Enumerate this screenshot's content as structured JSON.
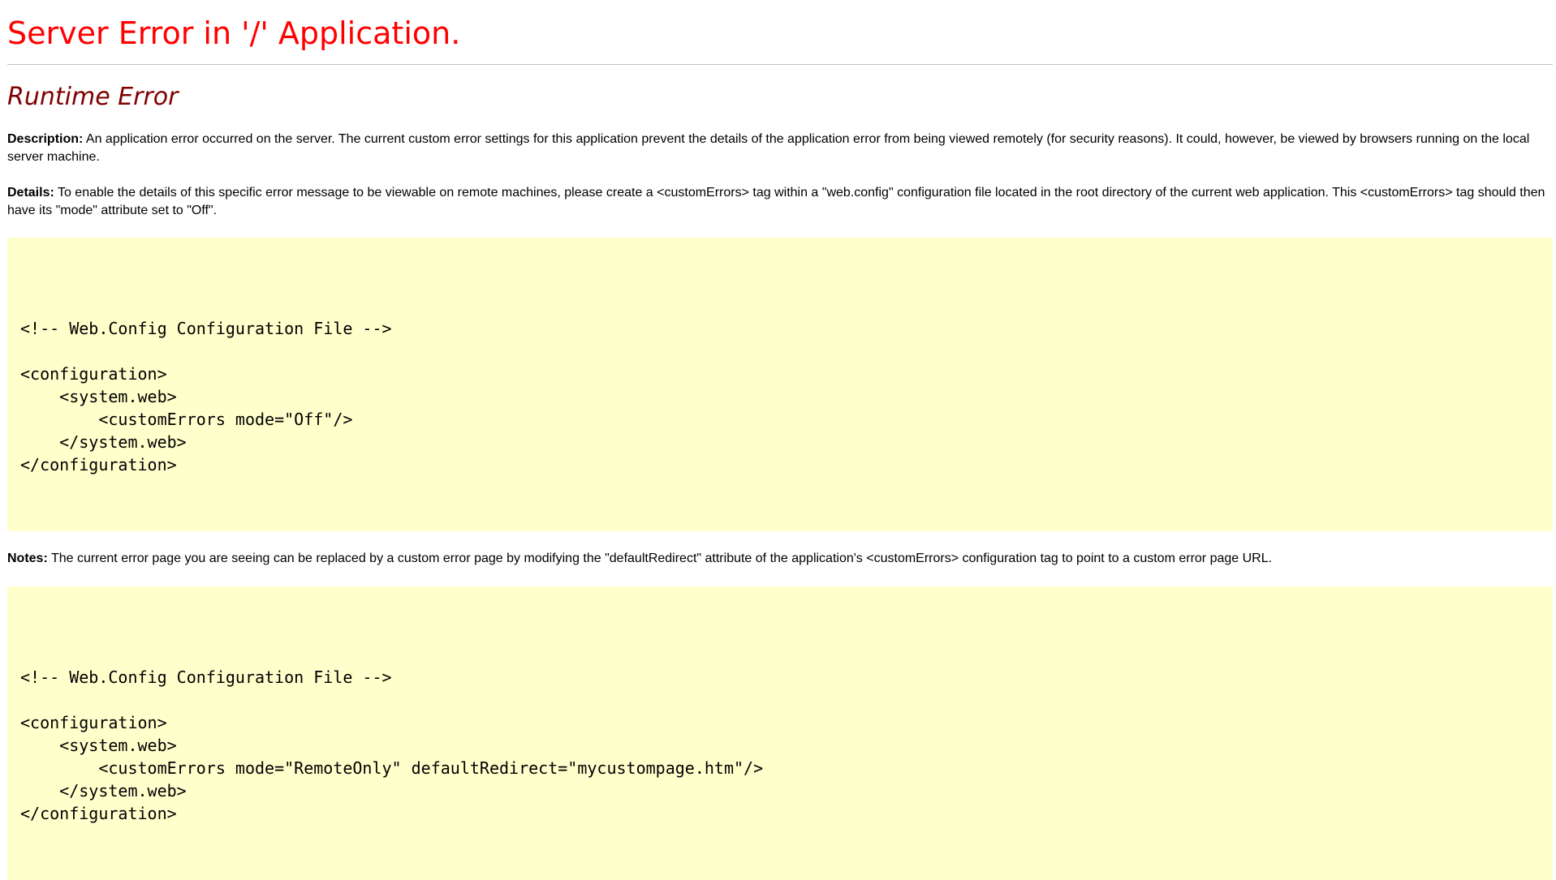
{
  "page": {
    "title": "Server Error in '/' Application.",
    "subtitle": "Runtime Error",
    "description": {
      "label": "Description:",
      "text": " An application error occurred on the server. The current custom error settings for this application prevent the details of the application error from being viewed remotely (for security reasons). It could, however, be viewed by browsers running on the local server machine."
    },
    "details": {
      "label": "Details:",
      "text": " To enable the details of this specific error message to be viewable on remote machines, please create a <customErrors> tag within a \"web.config\" configuration file located in the root directory of the current web application. This <customErrors> tag should then have its \"mode\" attribute set to \"Off\"."
    },
    "code1": [
      "<!-- Web.Config Configuration File -->",
      "",
      "<configuration>",
      "    <system.web>",
      "        <customErrors mode=\"Off\"/>",
      "    </system.web>",
      "</configuration>"
    ],
    "notes": {
      "label": "Notes:",
      "text": " The current error page you are seeing can be replaced by a custom error page by modifying the \"defaultRedirect\" attribute of the application's <customErrors> configuration tag to point to a custom error page URL."
    },
    "code2": [
      "<!-- Web.Config Configuration File -->",
      "",
      "<configuration>",
      "    <system.web>",
      "        <customErrors mode=\"RemoteOnly\" defaultRedirect=\"mycustompage.htm\"/>",
      "    </system.web>",
      "</configuration>"
    ],
    "colors": {
      "title": "#ff0000",
      "subtitle": "#800000",
      "code_background": "#ffffcc",
      "rule": "#c0c0c0"
    }
  }
}
